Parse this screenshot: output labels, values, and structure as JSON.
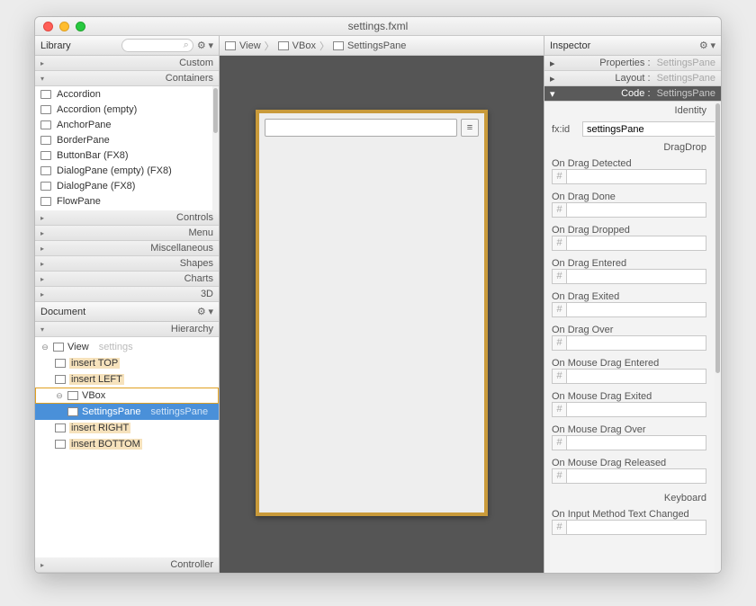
{
  "window": {
    "title": "settings.fxml"
  },
  "library": {
    "title": "Library",
    "search_placeholder": "",
    "sections": {
      "custom": "Custom",
      "containers": "Containers",
      "controls": "Controls",
      "menu": "Menu",
      "miscellaneous": "Miscellaneous",
      "shapes": "Shapes",
      "charts": "Charts",
      "three_d": "3D"
    },
    "items": [
      "Accordion",
      "Accordion  (empty)",
      "AnchorPane",
      "BorderPane",
      "ButtonBar   (FX8)",
      "DialogPane (empty)   (FX8)",
      "DialogPane   (FX8)",
      "FlowPane"
    ]
  },
  "document": {
    "title": "Document",
    "hierarchy_label": "Hierarchy",
    "controller_label": "Controller",
    "tree": {
      "view": {
        "name": "View",
        "hint": "settings"
      },
      "insert_top": "insert TOP",
      "insert_left": "insert LEFT",
      "vbox": "VBox",
      "settings_pane": {
        "name": "SettingsPane",
        "hint": "settingsPane"
      },
      "insert_right": "insert RIGHT",
      "insert_bottom": "insert BOTTOM"
    }
  },
  "breadcrumb": {
    "items": [
      "View",
      "VBox",
      "SettingsPane"
    ]
  },
  "inspector": {
    "title": "Inspector",
    "properties": {
      "label": "Properties",
      "target": "SettingsPane"
    },
    "layout": {
      "label": "Layout",
      "target": "SettingsPane"
    },
    "code": {
      "label": "Code",
      "target": "SettingsPane"
    },
    "identity_label": "Identity",
    "fxid_label": "fx:id",
    "fxid_value": "settingsPane",
    "dragdrop_label": "DragDrop",
    "events": [
      "On Drag Detected",
      "On Drag Done",
      "On Drag Dropped",
      "On Drag Entered",
      "On Drag Exited",
      "On Drag Over",
      "On Mouse Drag Entered",
      "On Mouse Drag Exited",
      "On Mouse Drag Over",
      "On Mouse Drag Released"
    ],
    "keyboard_label": "Keyboard",
    "keyboard_events": [
      "On Input Method Text Changed"
    ],
    "hash": "#"
  },
  "icons": {
    "gear": "⚙",
    "search": "⌕",
    "menu": "≡",
    "tri_right": "▸",
    "tri_down": "▾",
    "disc_minus": "⊖",
    "sep": "〉"
  }
}
